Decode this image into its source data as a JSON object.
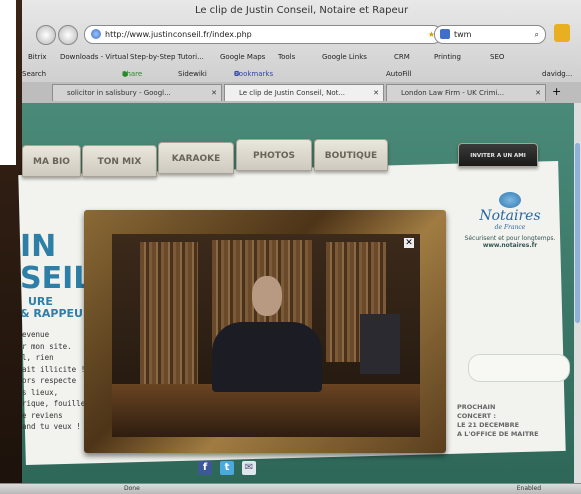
{
  "window": {
    "title": "Le clip de Justin Conseil, Notaire et Rapeur"
  },
  "nav": {
    "url": "http://www.justinconseil.fr/index.php",
    "search_value": "twm"
  },
  "bookmarks": [
    "Bitrix",
    "Downloads - Virtual",
    "Step-by-Step Tutori...",
    "Google Maps",
    "Tools",
    "Google Links",
    "CRM",
    "Printing",
    "SEO"
  ],
  "toolbar2": {
    "search": "Search",
    "share": "Share",
    "sidewiki": "Sidewiki",
    "bookmarks": "Bookmarks",
    "autofill": "AutoFill",
    "user": "davidg..."
  },
  "tabs": [
    {
      "label": "solicitor in salisbury - Googl...",
      "active": false
    },
    {
      "label": "Le clip de Justin Conseil, Not...",
      "active": true
    },
    {
      "label": "London Law Firm - UK Crimi...",
      "active": false
    }
  ],
  "site": {
    "folders": [
      "MA BIO",
      "TON MIX",
      "KARAOKE",
      "PHOTOS",
      "BOUTIQUE",
      "INVITER A UN AMI"
    ],
    "left_big_1": "IN",
    "left_big_2": "SEIL",
    "left_small_1": "URE",
    "left_small_2": "& RAPPEUR",
    "left_lines": [
      "evenue",
      "r mon site.",
      "l, rien",
      "ait illicite !",
      "ors respecte",
      "s lieux,",
      "rique, fouille",
      "e reviens",
      "and tu veux !"
    ],
    "notaires_name": "Notaires",
    "notaires_sub": "de France",
    "notaires_tag": "Sécurisent et pour longtemps.",
    "notaires_url": "www.notaires.fr",
    "prochain": [
      "PROCHAIN",
      "CONCERT :",
      "LE 21 DECEMBRE",
      "A L'OFFICE DE MAITRE"
    ],
    "social": [
      "facebook-icon",
      "twitter-icon",
      "email-icon"
    ]
  },
  "status": {
    "text": "Done",
    "right": "Enabled"
  },
  "colors": {
    "page_bg": "#3e7b6a",
    "title_blue": "#2e7fa7",
    "frame_gold": "#8a6a35"
  }
}
